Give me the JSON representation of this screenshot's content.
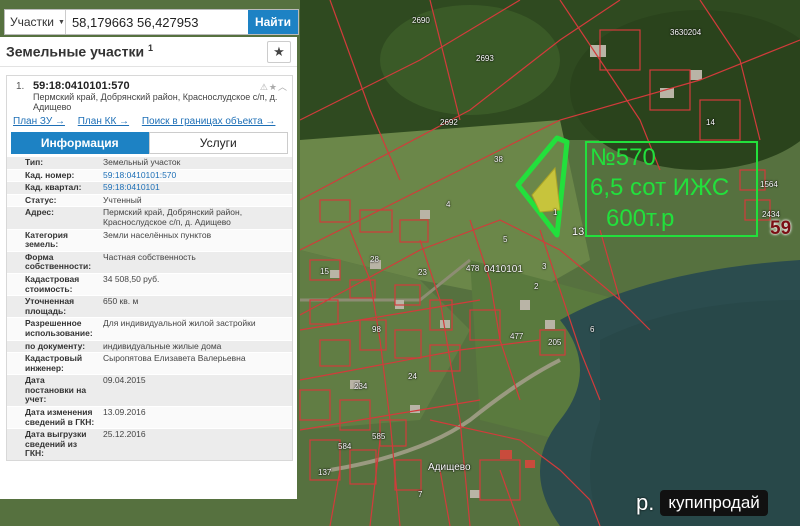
{
  "search": {
    "type_label": "Участки",
    "value": "58,179663 56,427953",
    "button_label": "Найти"
  },
  "panel": {
    "title": "Земельные участки",
    "title_sup": "1"
  },
  "item": {
    "number": "1.",
    "cad_id": "59:18:0410101:570",
    "address": "Пермский край, Добрянский район, Краснослудское с/п, д. Адищево",
    "links": [
      "План ЗУ →",
      "План КК →",
      "Поиск в границах объекта →"
    ]
  },
  "tabs": {
    "info": "Информация",
    "services": "Услуги"
  },
  "info_rows": [
    {
      "k": "Тип:",
      "v": "Земельный участок"
    },
    {
      "k": "Кад. номер:",
      "v": "59:18:0410101:570"
    },
    {
      "k": "Кад. квартал:",
      "v": "59:18:0410101"
    },
    {
      "k": "Статус:",
      "v": "Учтенный"
    },
    {
      "k": "Адрес:",
      "v": "Пермский край, Добрянский район, Краснослудское с/п, д. Адищево"
    },
    {
      "k": "Категория земель:",
      "v": "Земли населённых пунктов"
    },
    {
      "k": "Форма собственности:",
      "v": "Частная собственность"
    },
    {
      "k": "Кадастровая стоимость:",
      "v": "34 508,50 руб."
    },
    {
      "k": "Уточненная площадь:",
      "v": "650 кв. м"
    },
    {
      "k": "Разрешенное использование:",
      "v": "Для индивидуальной жилой застройки"
    },
    {
      "k": "по документу:",
      "v": "индивидуальные жилые дома"
    },
    {
      "k": "Кадастровый инженер:",
      "v": "Сыропятова Елизавета Валерьевна"
    },
    {
      "k": "Дата постановки на учет:",
      "v": "09.04.2015"
    },
    {
      "k": "Дата изменения сведений в ГКН:",
      "v": "13.09.2016"
    },
    {
      "k": "Дата выгрузки сведений из ГКН:",
      "v": "25.12.2016"
    }
  ],
  "map": {
    "labels": [
      "2690",
      "2693",
      "3630204",
      "14",
      "1564",
      "2434",
      "2692",
      "38",
      "13",
      "0410101",
      "478",
      "3",
      "2",
      "1",
      "5",
      "6",
      "205",
      "477",
      "23",
      "28",
      "15",
      "98",
      "234",
      "585",
      "584",
      "137",
      "24",
      "4",
      "7",
      "Адищево"
    ],
    "region": "59"
  },
  "annotation": {
    "line1": "№570",
    "line2": "6,5 сот ИЖС",
    "line3": "600т.р"
  },
  "watermark": {
    "prefix": "р.",
    "brand": "купипродай"
  },
  "colors": {
    "accent": "#1d82c4",
    "annotation": "#22e03c",
    "boundary": "#d23b3b"
  }
}
